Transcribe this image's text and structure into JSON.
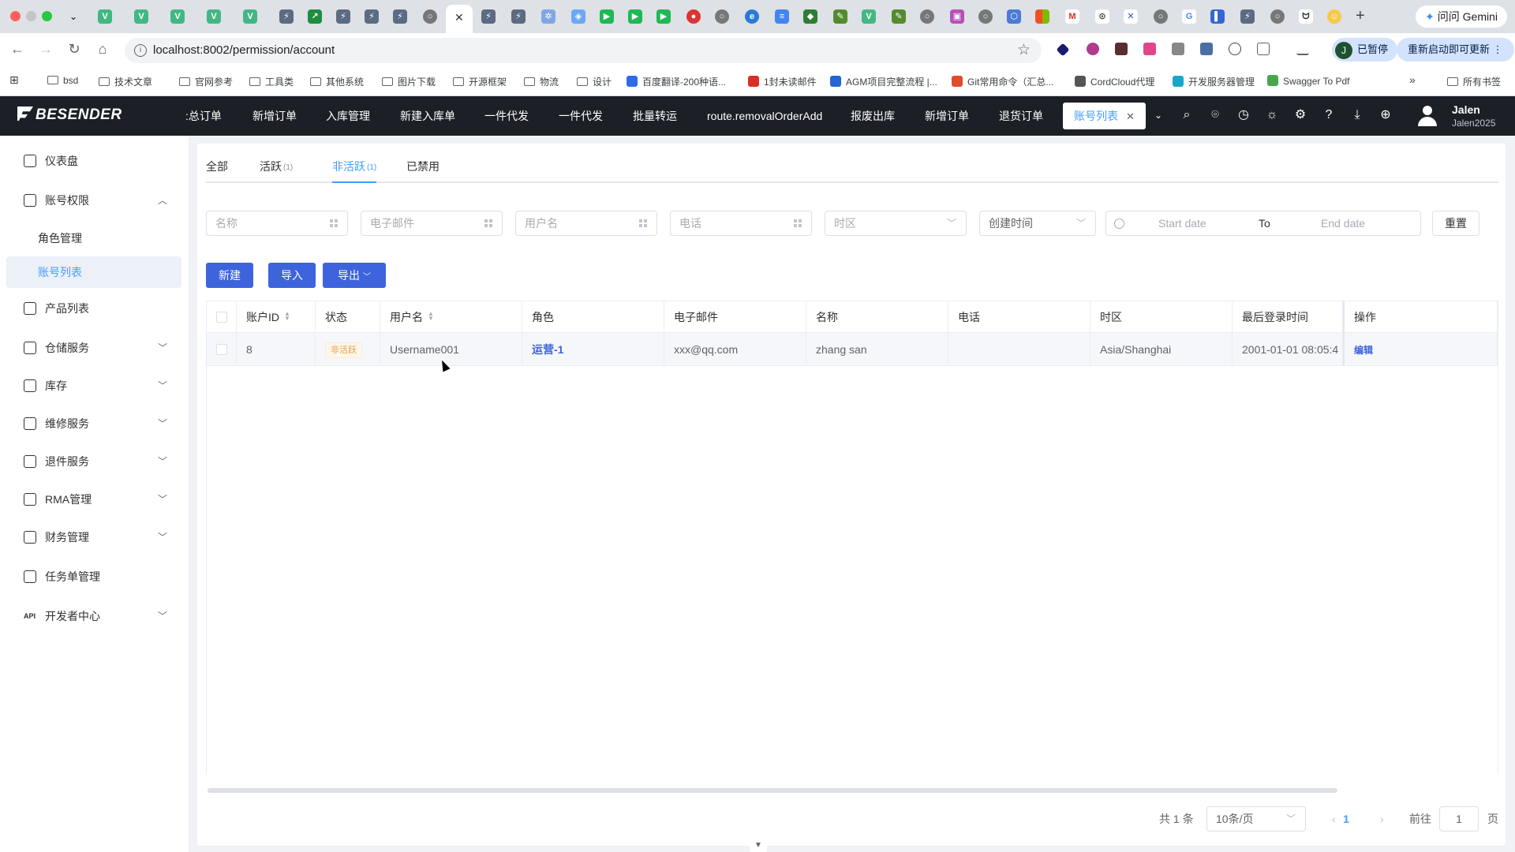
{
  "browser": {
    "url": "localhost:8002/permission/account",
    "gemini_label": "问问 Gemini",
    "paused_label": "已暂停",
    "profile_initial": "J",
    "update_label": "重新启动即可更新",
    "bookmarks": [
      "bsd",
      "技术文章",
      "官网参考",
      "工具类",
      "其他系统",
      "图片下载",
      "开源框架",
      "物流",
      "设计",
      "百度翻译-200种语...",
      "1封未读邮件",
      "AGM项目完整流程 |...",
      "Git常用命令（汇总...",
      "CordCloud代理",
      "开发服务器管理",
      "Swagger To Pdf"
    ],
    "all_bookmarks_label": "所有书签"
  },
  "header": {
    "logo": "BESENDER",
    "tabs": [
      ":总订单",
      "新增订单",
      "入库管理",
      "新建入库单",
      "一件代发",
      "一件代发",
      "批量转运",
      "route.removalOrderAdd",
      "报废出库",
      "新增订单",
      "退货订单"
    ],
    "active_tab": "账号列表",
    "user_name": "Jalen",
    "user_sub": "Jalen2025"
  },
  "sidebar": {
    "items": [
      {
        "label": "仪表盘",
        "icon": "home-icon"
      },
      {
        "label": "账号权限",
        "icon": "user-key-icon"
      },
      {
        "label": "角色管理"
      },
      {
        "label": "账号列表"
      },
      {
        "label": "产品列表",
        "icon": "product-icon"
      },
      {
        "label": "仓储服务",
        "icon": "warehouse-icon"
      },
      {
        "label": "库存",
        "icon": "inventory-icon"
      },
      {
        "label": "维修服务",
        "icon": "wrench-icon"
      },
      {
        "label": "退件服务",
        "icon": "return-icon"
      },
      {
        "label": "RMA管理",
        "icon": "rma-icon"
      },
      {
        "label": "财务管理",
        "icon": "finance-icon"
      },
      {
        "label": "任务单管理",
        "icon": "task-icon"
      },
      {
        "label": "开发者中心",
        "icon": "api-icon"
      }
    ]
  },
  "status_tabs": [
    {
      "label": "全部",
      "count": ""
    },
    {
      "label": "活跃",
      "count": "(1)"
    },
    {
      "label": "非活跃",
      "count": "(1)"
    },
    {
      "label": "已禁用",
      "count": ""
    }
  ],
  "filters": {
    "name_placeholder": "名称",
    "email_placeholder": "电子邮件",
    "username_placeholder": "用户名",
    "phone_placeholder": "电话",
    "timezone_placeholder": "时区",
    "time_type_value": "创建时间",
    "start_placeholder": "Start date",
    "to_label": "To",
    "end_placeholder": "End date",
    "reset_label": "重置"
  },
  "actions": {
    "new_label": "新建",
    "import_label": "导入",
    "export_label": "导出"
  },
  "table": {
    "headers": [
      "账户ID",
      "状态",
      "用户名",
      "角色",
      "电子邮件",
      "名称",
      "电话",
      "时区",
      "最后登录时间",
      "操作"
    ],
    "rows": [
      {
        "id": "8",
        "status": "非活跃",
        "username": "Username001",
        "role": "运营-1",
        "email": "xxx@qq.com",
        "name": "zhang san",
        "phone": "",
        "timezone": "Asia/Shanghai",
        "last_login": "2001-01-01 08:05:4",
        "action": "编辑"
      }
    ]
  },
  "pagination": {
    "total": "共 1 条",
    "page_size": "10条/页",
    "current": "1",
    "goto_label": "前往",
    "goto_value": "1",
    "page_suffix": "页"
  }
}
